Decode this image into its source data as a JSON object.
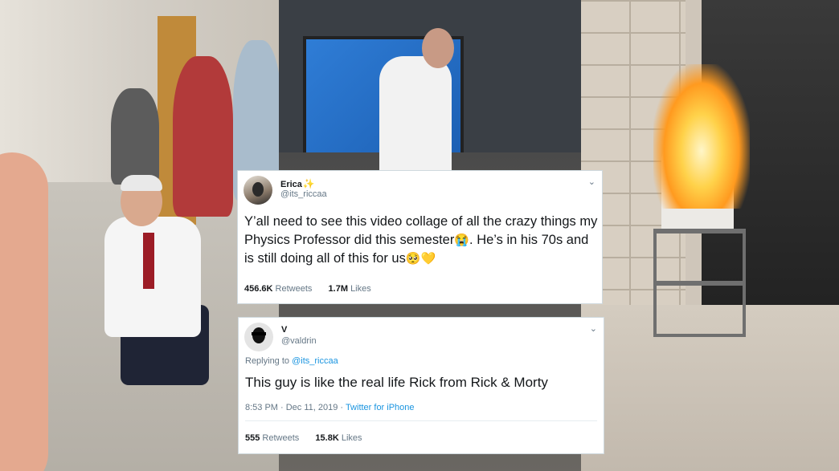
{
  "tweet_main": {
    "display_name": "Erica",
    "sparkle_icon": "✨",
    "handle": "@its_riccaa",
    "menu_icon": "⌄",
    "text_part1": "Y’all need to see this video collage of all the crazy things my Physics Professor did this semester",
    "emoji_cry": "😭",
    "text_part2": ". He’s in his 70s and is still doing all of this for us",
    "emoji_smile": "🥺",
    "emoji_heart": "💛",
    "retweets_count": "456.6K",
    "retweets_label": "Retweets",
    "likes_count": "1.7M",
    "likes_label": "Likes"
  },
  "tweet_reply": {
    "display_name": "V",
    "handle": "@valdrin",
    "menu_icon": "⌄",
    "replying_label": "Replying to",
    "replying_handle": "@its_riccaa",
    "text": "This guy is like the real life Rick from Rick & Morty",
    "time": "8:53 PM · Dec 11, 2019 · ",
    "source": "Twitter for iPhone",
    "retweets_count": "555",
    "retweets_label": "Retweets",
    "likes_count": "15.8K",
    "likes_label": "Likes"
  },
  "colors": {
    "link": "#1b95e0",
    "secondary_text": "#657786",
    "primary_text": "#14171a",
    "card_border": "#cfd9de"
  },
  "icons": [
    "sparkle-icon",
    "chevron-down-icon",
    "avatar"
  ]
}
